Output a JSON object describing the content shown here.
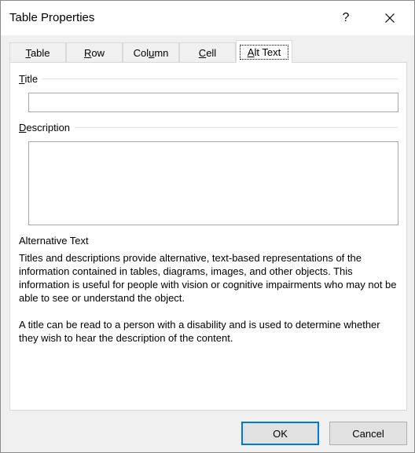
{
  "dialog": {
    "title": "Table Properties",
    "help_glyph": "?"
  },
  "tabs": [
    {
      "label": "Table",
      "mnemonic": "T",
      "rest": "able"
    },
    {
      "label": "Row",
      "mnemonic": "R",
      "rest": "ow"
    },
    {
      "label": "Column",
      "prefix": "Col",
      "mnemonic": "u",
      "rest": "mn"
    },
    {
      "label": "Cell",
      "mnemonic": "C",
      "rest": "ell"
    },
    {
      "label": "Alt Text",
      "prefix": "",
      "mnemonic": "A",
      "rest": "lt Text"
    }
  ],
  "active_tab": "Alt Text",
  "alt_text": {
    "title_label_mn": "T",
    "title_label_rest": "itle",
    "title_value": "",
    "description_label_mn": "D",
    "description_label_rest": "escription",
    "description_value": "",
    "heading": "Alternative Text",
    "paragraph1": "Titles and descriptions provide alternative, text-based representations of the information contained in tables, diagrams, images, and other objects. This information is useful for people with vision or cognitive impairments who may not be able to see or understand the object.",
    "paragraph2": "A title can be read to a person with a disability and is used to determine whether they wish to hear the description of the content."
  },
  "buttons": {
    "ok": "OK",
    "cancel": "Cancel"
  },
  "colors": {
    "accent": "#0078d7"
  }
}
